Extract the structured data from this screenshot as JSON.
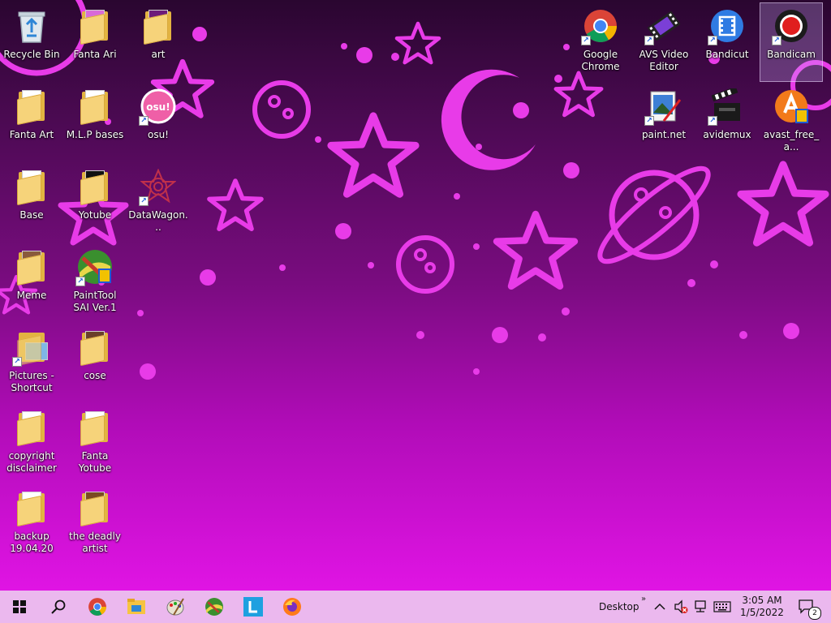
{
  "desktop": {
    "icons": [
      {
        "label": "Recycle Bin",
        "name": "recycle-bin-icon"
      },
      {
        "label": "Fanta Ari",
        "name": "folder-icon"
      },
      {
        "label": "art",
        "name": "folder-icon"
      },
      {
        "label": "Fanta Art",
        "name": "folder-icon"
      },
      {
        "label": "M.L.P bases",
        "name": "folder-icon"
      },
      {
        "label": "osu!",
        "name": "osu-icon"
      },
      {
        "label": "Base",
        "name": "folder-icon"
      },
      {
        "label": "Yotube",
        "name": "folder-icon"
      },
      {
        "label": "DataWagon...",
        "name": "datawagon-icon"
      },
      {
        "label": "Meme",
        "name": "folder-icon"
      },
      {
        "label": "PaintTool SAI Ver.1",
        "name": "painttool-sai-icon"
      },
      {
        "label": "Pictures - Shortcut",
        "name": "pictures-shortcut-icon"
      },
      {
        "label": "cose",
        "name": "folder-icon"
      },
      {
        "label": "copyright disclaimer",
        "name": "document-icon"
      },
      {
        "label": "Fanta Yotube",
        "name": "folder-icon"
      },
      {
        "label": "backup 19.04.20",
        "name": "folder-icon"
      },
      {
        "label": "the deadly artist",
        "name": "folder-icon"
      },
      {
        "label": "Google Chrome",
        "name": "chrome-icon"
      },
      {
        "label": "AVS Video Editor",
        "name": "avs-video-editor-icon"
      },
      {
        "label": "Bandicut",
        "name": "bandicut-icon"
      },
      {
        "label": "Bandicam",
        "name": "bandicam-icon"
      },
      {
        "label": "paint.net",
        "name": "paintnet-icon"
      },
      {
        "label": "avidemux",
        "name": "avidemux-icon"
      },
      {
        "label": "avast_free_a...",
        "name": "avast-icon"
      }
    ]
  },
  "taskbar": {
    "pinned": [
      {
        "name": "start-icon"
      },
      {
        "name": "search-icon"
      },
      {
        "name": "chrome-icon"
      },
      {
        "name": "file-explorer-icon"
      },
      {
        "name": "paint-icon"
      },
      {
        "name": "painttool-sai-icon"
      },
      {
        "name": "l-app-icon"
      },
      {
        "name": "firefox-icon"
      }
    ],
    "toolbar_label": "Desktop",
    "clock_time": "3:05 AM",
    "clock_date": "1/5/2022",
    "notification_count": "2"
  },
  "colors": {
    "taskbar_bg": "#ebb8ee",
    "wallpaper_accent": "#e83be8"
  }
}
